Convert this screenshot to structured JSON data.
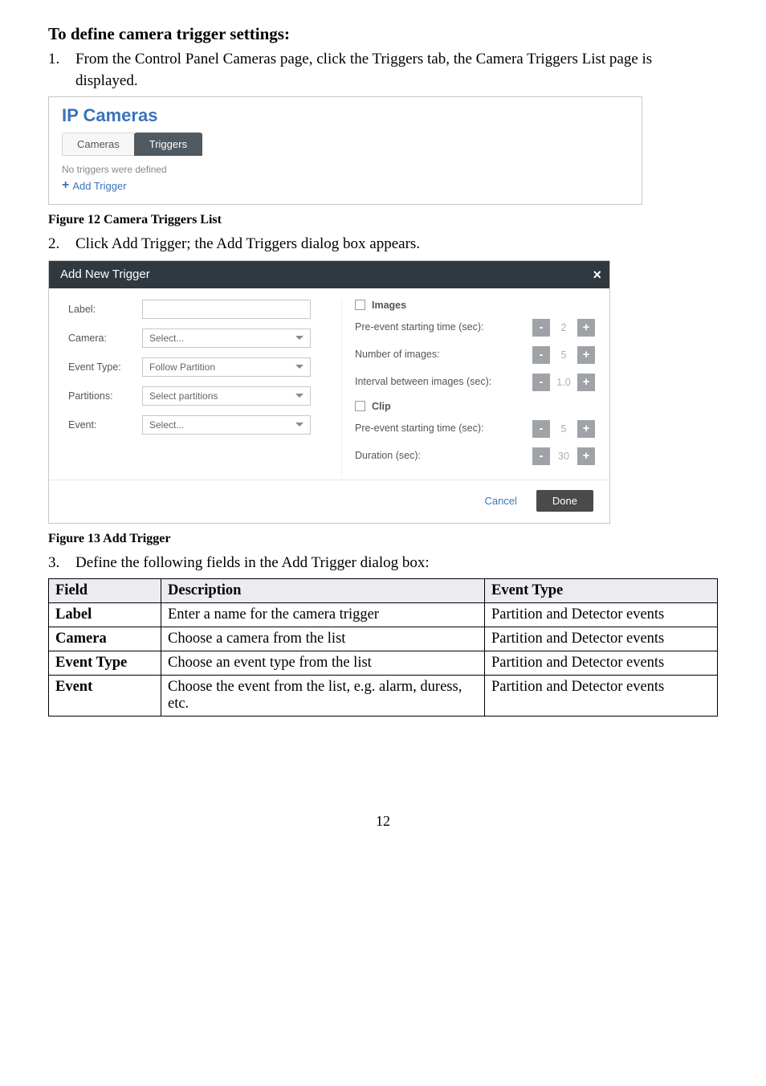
{
  "heading": "To define camera trigger settings:",
  "steps": {
    "s1": {
      "num": "1.",
      "text": "From the Control Panel Cameras page, click the Triggers tab, the Camera Triggers List page is displayed."
    },
    "s2": {
      "num": "2.",
      "text": "Click Add Trigger; the Add Triggers dialog box appears."
    },
    "s3": {
      "num": "3.",
      "text": "Define the following fields in the Add Trigger dialog box:"
    }
  },
  "fig1": {
    "title": "IP Cameras",
    "tab_cameras": "Cameras",
    "tab_triggers": "Triggers",
    "no_defined": "No triggers were defined",
    "add_label": "Add Trigger",
    "caption": "Figure 12 Camera Triggers List"
  },
  "fig2": {
    "header": "Add New Trigger",
    "labels": {
      "label": "Label:",
      "camera": "Camera:",
      "event_type": "Event Type:",
      "partitions": "Partitions:",
      "event": "Event:"
    },
    "selects": {
      "camera": "Select...",
      "event_type": "Follow Partition",
      "partitions": "Select partitions",
      "event": "Select..."
    },
    "right": {
      "images_head": "Images",
      "pre_event_images": "Pre-event starting time (sec):",
      "num_images": "Number of images:",
      "interval": "Interval between images (sec):",
      "clip_head": "Clip",
      "pre_event_clip": "Pre-event starting time (sec):",
      "duration": "Duration (sec):"
    },
    "vals": {
      "pre_event_images": "2",
      "num_images": "5",
      "interval": "1.0",
      "pre_event_clip": "5",
      "duration": "30"
    },
    "minus": "-",
    "plus": "+",
    "cancel": "Cancel",
    "done": "Done",
    "caption": "Figure 13 Add Trigger"
  },
  "table": {
    "header": {
      "field": "Field",
      "description": "Description",
      "event_type": "Event Type"
    },
    "rows": [
      {
        "field": "Label",
        "desc": "Enter a name for the camera trigger",
        "etype": "Partition and Detector events"
      },
      {
        "field": "Camera",
        "desc": "Choose a camera from the list",
        "etype": "Partition and Detector events"
      },
      {
        "field": "Event Type",
        "desc": "Choose an event type from the list",
        "etype": "Partition and Detector events"
      },
      {
        "field": "Event",
        "desc": "Choose the event from the list, e.g. alarm, duress, etc.",
        "etype": "Partition and Detector events"
      }
    ]
  },
  "page_number": "12"
}
